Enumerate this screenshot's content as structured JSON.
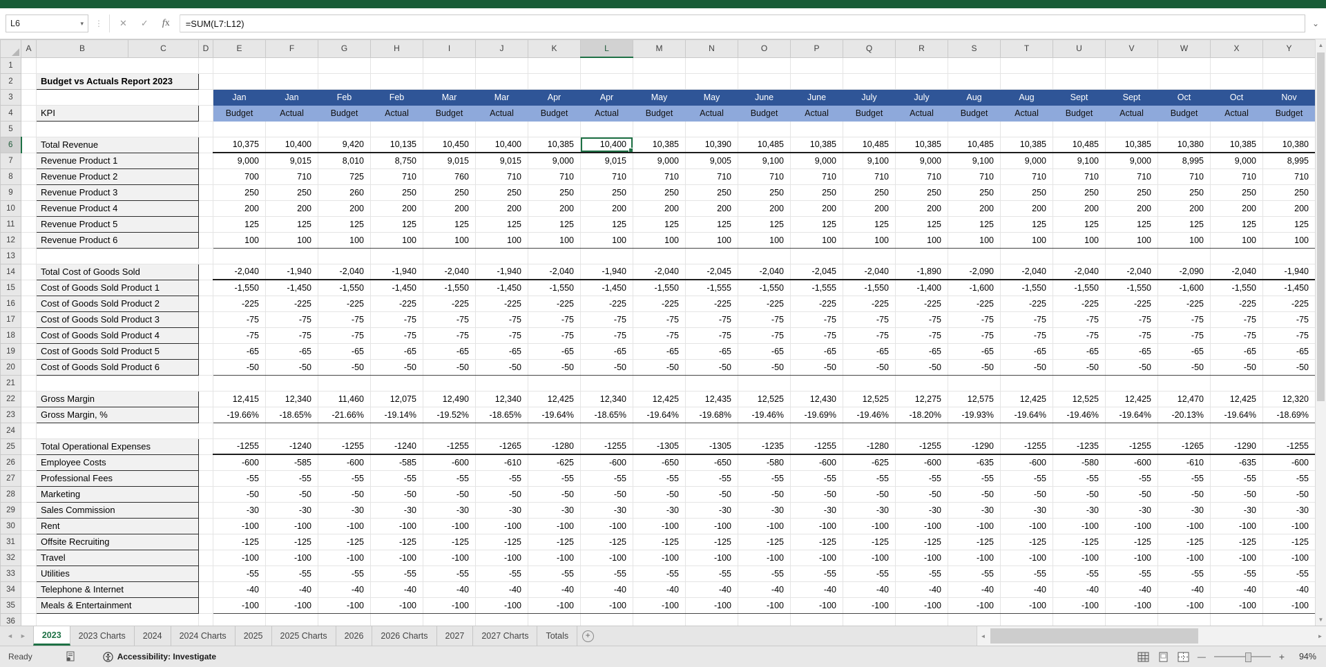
{
  "colors": {
    "excel_green": "#185C37",
    "selection_green": "#1E7145",
    "header_blue": "#2F5597",
    "subheader_blue": "#8EA9DB",
    "label_fill": "#F1F1F1"
  },
  "formula_bar": {
    "name_box": "L6",
    "formula": "=SUM(L7:L12)",
    "cancel_icon": "✕",
    "enter_icon": "✓",
    "fx_icon": "fx"
  },
  "sheet": {
    "title": "Budget vs Actuals Report 2023",
    "kpi_label": "KPI",
    "columns": [
      "A",
      "B",
      "C",
      "D",
      "E",
      "F",
      "G",
      "H",
      "I",
      "J",
      "K",
      "L",
      "M",
      "N",
      "O",
      "P",
      "Q",
      "R",
      "S",
      "T",
      "U",
      "V",
      "W",
      "X",
      "Y"
    ],
    "visible_rows": 36,
    "selected": {
      "cell": "L6",
      "column": "L",
      "row": 6
    },
    "months": [
      "Jan",
      "Jan",
      "Feb",
      "Feb",
      "Mar",
      "Mar",
      "Apr",
      "Apr",
      "May",
      "May",
      "June",
      "June",
      "July",
      "July",
      "Aug",
      "Aug",
      "Sept",
      "Sept",
      "Oct",
      "Oct",
      "Nov"
    ],
    "periods": [
      "Budget",
      "Actual",
      "Budget",
      "Actual",
      "Budget",
      "Actual",
      "Budget",
      "Actual",
      "Budget",
      "Actual",
      "Budget",
      "Actual",
      "Budget",
      "Actual",
      "Budget",
      "Actual",
      "Budget",
      "Actual",
      "Budget",
      "Actual",
      "Budget"
    ],
    "rows": [
      {
        "n": 6,
        "label": "Total Revenue",
        "underline": "thick",
        "values": [
          "10,375",
          "10,400",
          "9,420",
          "10,135",
          "10,450",
          "10,400",
          "10,385",
          "10,400",
          "10,385",
          "10,390",
          "10,485",
          "10,385",
          "10,485",
          "10,385",
          "10,485",
          "10,385",
          "10,485",
          "10,385",
          "10,380",
          "10,385",
          "10,380"
        ]
      },
      {
        "n": 7,
        "label": "Revenue Product 1",
        "values": [
          "9,000",
          "9,015",
          "8,010",
          "8,750",
          "9,015",
          "9,015",
          "9,000",
          "9,015",
          "9,000",
          "9,005",
          "9,100",
          "9,000",
          "9,100",
          "9,000",
          "9,100",
          "9,000",
          "9,100",
          "9,000",
          "8,995",
          "9,000",
          "8,995"
        ]
      },
      {
        "n": 8,
        "label": "Revenue Product 2",
        "values": [
          "700",
          "710",
          "725",
          "710",
          "760",
          "710",
          "710",
          "710",
          "710",
          "710",
          "710",
          "710",
          "710",
          "710",
          "710",
          "710",
          "710",
          "710",
          "710",
          "710",
          "710"
        ]
      },
      {
        "n": 9,
        "label": "Revenue Product 3",
        "values": [
          "250",
          "250",
          "260",
          "250",
          "250",
          "250",
          "250",
          "250",
          "250",
          "250",
          "250",
          "250",
          "250",
          "250",
          "250",
          "250",
          "250",
          "250",
          "250",
          "250",
          "250"
        ]
      },
      {
        "n": 10,
        "label": "Revenue Product 4",
        "value_all": "200"
      },
      {
        "n": 11,
        "label": "Revenue Product 5",
        "value_all": "125"
      },
      {
        "n": 12,
        "label": "Revenue Product 6",
        "value_all": "100",
        "underline": "thin"
      },
      {
        "n": 14,
        "label": "Total Cost of Goods Sold",
        "underline": "thick",
        "values": [
          "-2,040",
          "-1,940",
          "-2,040",
          "-1,940",
          "-2,040",
          "-1,940",
          "-2,040",
          "-1,940",
          "-2,040",
          "-2,045",
          "-2,040",
          "-2,045",
          "-2,040",
          "-1,890",
          "-2,090",
          "-2,040",
          "-2,040",
          "-2,040",
          "-2,090",
          "-2,040",
          "-1,940"
        ]
      },
      {
        "n": 15,
        "label": "Cost of Goods Sold Product 1",
        "values": [
          "-1,550",
          "-1,450",
          "-1,550",
          "-1,450",
          "-1,550",
          "-1,450",
          "-1,550",
          "-1,450",
          "-1,550",
          "-1,555",
          "-1,550",
          "-1,555",
          "-1,550",
          "-1,400",
          "-1,600",
          "-1,550",
          "-1,550",
          "-1,550",
          "-1,600",
          "-1,550",
          "-1,450"
        ]
      },
      {
        "n": 16,
        "label": "Cost of Goods Sold Product 2",
        "value_all": "-225"
      },
      {
        "n": 17,
        "label": "Cost of Goods Sold Product 3",
        "value_all": "-75"
      },
      {
        "n": 18,
        "label": "Cost of Goods Sold Product 4",
        "value_all": "-75"
      },
      {
        "n": 19,
        "label": "Cost of Goods Sold Product 5",
        "value_all": "-65"
      },
      {
        "n": 20,
        "label": "Cost of Goods Sold Product 6",
        "value_all": "-50",
        "underline": "thin"
      },
      {
        "n": 22,
        "label": "Gross Margin",
        "values": [
          "12,415",
          "12,340",
          "11,460",
          "12,075",
          "12,490",
          "12,340",
          "12,425",
          "12,340",
          "12,425",
          "12,435",
          "12,525",
          "12,430",
          "12,525",
          "12,275",
          "12,575",
          "12,425",
          "12,525",
          "12,425",
          "12,470",
          "12,425",
          "12,320"
        ]
      },
      {
        "n": 23,
        "label": "Gross Margin, %",
        "underline": "thin",
        "values": [
          "-19.66%",
          "-18.65%",
          "-21.66%",
          "-19.14%",
          "-19.52%",
          "-18.65%",
          "-19.64%",
          "-18.65%",
          "-19.64%",
          "-19.68%",
          "-19.46%",
          "-19.69%",
          "-19.46%",
          "-18.20%",
          "-19.93%",
          "-19.64%",
          "-19.46%",
          "-19.64%",
          "-20.13%",
          "-19.64%",
          "-18.69%"
        ]
      },
      {
        "n": 25,
        "label": "Total Operational Expenses",
        "underline": "thick",
        "values": [
          "-1255",
          "-1240",
          "-1255",
          "-1240",
          "-1255",
          "-1265",
          "-1280",
          "-1255",
          "-1305",
          "-1305",
          "-1235",
          "-1255",
          "-1280",
          "-1255",
          "-1290",
          "-1255",
          "-1235",
          "-1255",
          "-1265",
          "-1290",
          "-1255"
        ]
      },
      {
        "n": 26,
        "label": "Employee Costs",
        "values": [
          "-600",
          "-585",
          "-600",
          "-585",
          "-600",
          "-610",
          "-625",
          "-600",
          "-650",
          "-650",
          "-580",
          "-600",
          "-625",
          "-600",
          "-635",
          "-600",
          "-580",
          "-600",
          "-610",
          "-635",
          "-600"
        ]
      },
      {
        "n": 27,
        "label": "Professional Fees",
        "value_all": "-55"
      },
      {
        "n": 28,
        "label": "Marketing",
        "value_all": "-50"
      },
      {
        "n": 29,
        "label": "Sales Commission",
        "value_all": "-30"
      },
      {
        "n": 30,
        "label": "Rent",
        "value_all": "-100"
      },
      {
        "n": 31,
        "label": "Offsite Recruiting",
        "value_all": "-125"
      },
      {
        "n": 32,
        "label": "Travel",
        "value_all": "-100"
      },
      {
        "n": 33,
        "label": "Utilities",
        "value_all": "-55"
      },
      {
        "n": 34,
        "label": "Telephone & Internet",
        "value_all": "-40"
      },
      {
        "n": 35,
        "label": "Meals & Entertainment",
        "value_all": "-100",
        "underline": "thin"
      }
    ]
  },
  "tabs": {
    "active": "2023",
    "items": [
      "2023",
      "2023 Charts",
      "2024",
      "2024 Charts",
      "2025",
      "2025 Charts",
      "2026",
      "2026 Charts",
      "2027",
      "2027 Charts",
      "Totals"
    ]
  },
  "status_bar": {
    "mode": "Ready",
    "accessibility": "Accessibility: Investigate",
    "zoom": "94%"
  }
}
